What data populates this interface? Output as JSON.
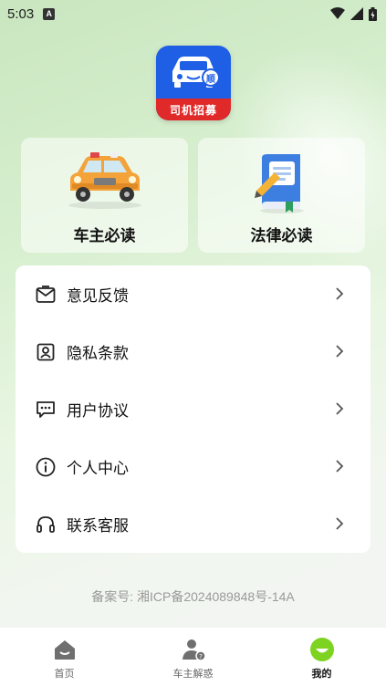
{
  "status_bar": {
    "time": "5:03",
    "badge": "A"
  },
  "app": {
    "logo_text": "司机招募",
    "logo_badge": "顺"
  },
  "quick_cards": [
    {
      "label": "车主必读",
      "icon": "car-icon"
    },
    {
      "label": "法律必读",
      "icon": "book-icon"
    }
  ],
  "menu": [
    {
      "label": "意见反馈",
      "icon": "mail-icon"
    },
    {
      "label": "隐私条款",
      "icon": "privacy-icon"
    },
    {
      "label": "用户协议",
      "icon": "chat-icon"
    },
    {
      "label": "个人中心",
      "icon": "info-icon"
    },
    {
      "label": "联系客服",
      "icon": "headset-icon"
    }
  ],
  "footer": {
    "icp": "备案号: 湘ICP备2024089848号-14A"
  },
  "tabbar": [
    {
      "label": "首页",
      "icon": "home-icon",
      "active": false
    },
    {
      "label": "车主解惑",
      "icon": "user-question-icon",
      "active": false
    },
    {
      "label": "我的",
      "icon": "smile-icon",
      "active": true
    }
  ],
  "colors": {
    "accent_green": "#7ed321",
    "logo_blue": "#1e5fe6",
    "logo_red": "#e02a2a"
  }
}
